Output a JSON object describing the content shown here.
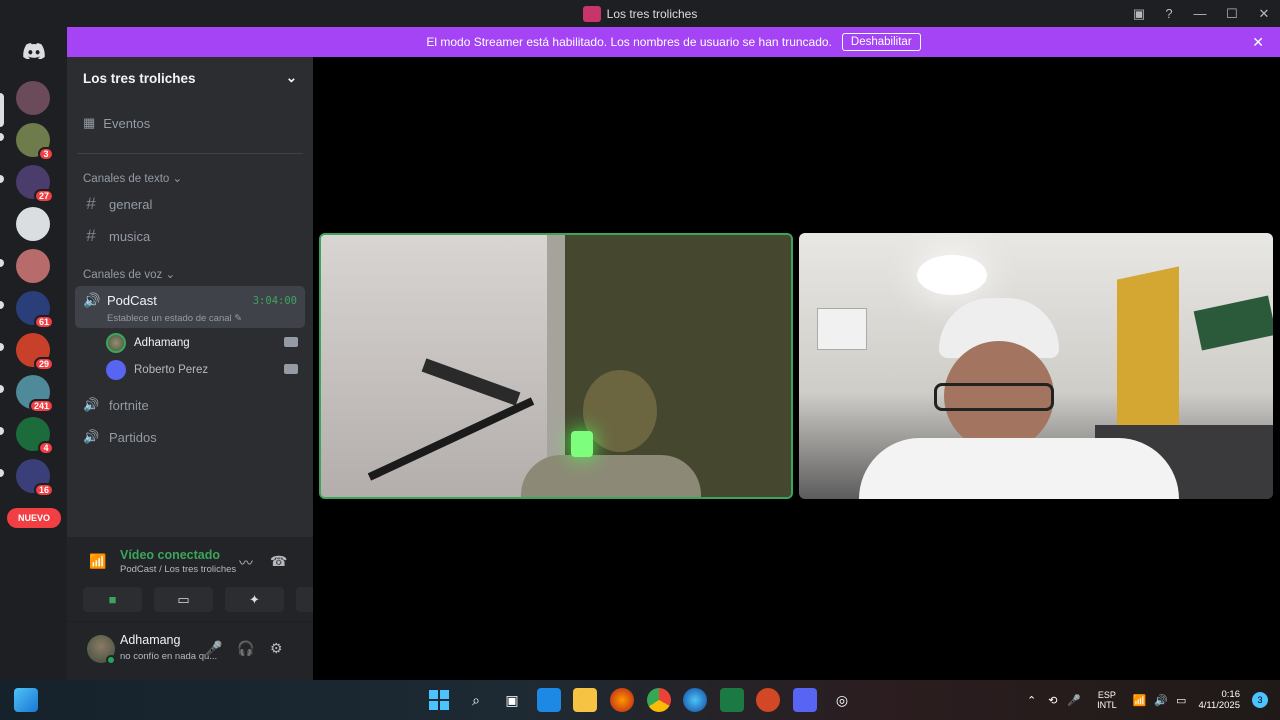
{
  "window": {
    "title": "Los tres troliches"
  },
  "banner": {
    "text": "El modo Streamer está habilitado. Los nombres de usuario se han truncado.",
    "button": "Deshabilitar",
    "close": "✕"
  },
  "servers": [
    {
      "badge": "",
      "color": "#6b4a5a"
    },
    {
      "badge": "3",
      "color": "#6d7c4a"
    },
    {
      "badge": "27",
      "color": "#4a3c6b"
    },
    {
      "badge": "",
      "color": "#dbdee1"
    },
    {
      "badge": "",
      "color": "#b86b6b"
    },
    {
      "badge": "61",
      "color": "#2a3f7a"
    },
    {
      "badge": "29",
      "color": "#c8402a"
    },
    {
      "badge": "241",
      "color": "#4e8a99"
    },
    {
      "badge": "4",
      "color": "#1c6b3a"
    },
    {
      "badge": "16",
      "color": "#3a3f7a"
    }
  ],
  "nuevo": "NUEVO",
  "guild": {
    "name": "Los tres troliches",
    "events": "Eventos",
    "text_category": "Canales de texto",
    "text_channels": [
      "general",
      "musica"
    ],
    "voice_category": "Canales de voz",
    "active_voice": {
      "name": "PodCast",
      "timer": "3:04:00",
      "subtitle": "Establece un estado de canal",
      "members": [
        "Adhamang",
        "Roberto Perez"
      ]
    },
    "voice_channels": [
      "fortnite",
      "Partidos"
    ]
  },
  "rtc": {
    "status": "Vídeo conectado",
    "location": "PodCast / Los tres troliches"
  },
  "user": {
    "name": "Adhamang",
    "status": "no confío en nada qu..."
  },
  "tray": {
    "lang_top": "ESP",
    "lang_bottom": "INTL",
    "time": "0:16",
    "date": "4/11/2025",
    "notif": "3"
  }
}
